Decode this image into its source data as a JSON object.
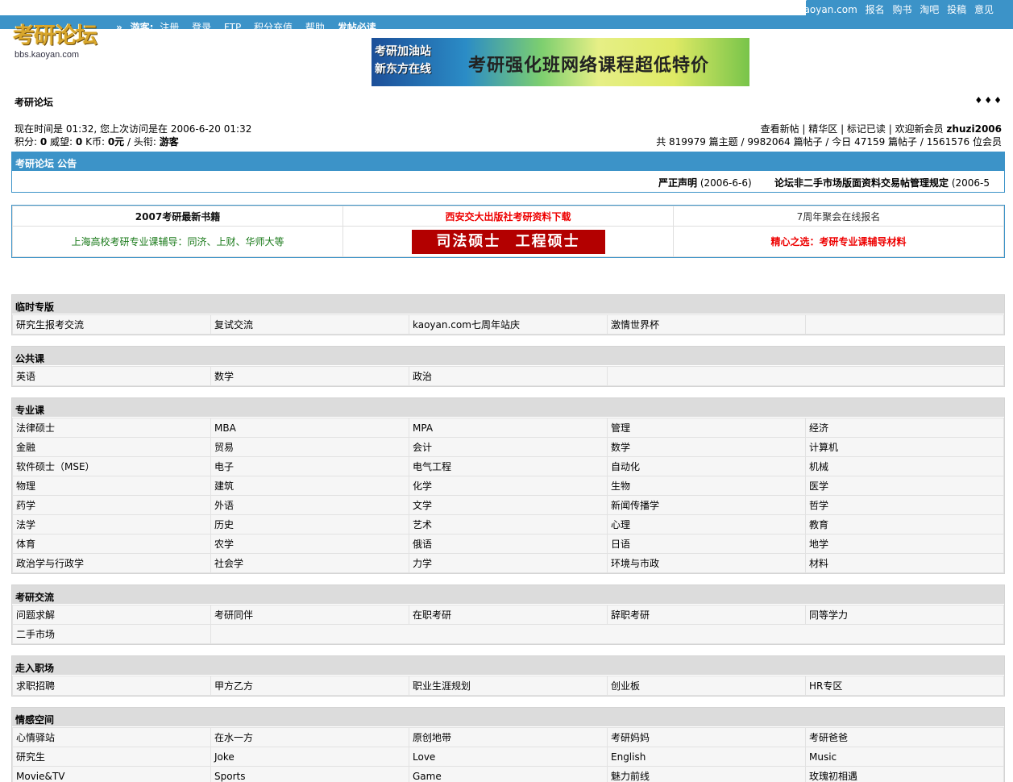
{
  "header": {
    "top_links": [
      "kaoyan.com",
      "报名",
      "购书",
      "淘吧",
      "投稿",
      "意见"
    ],
    "logo_text": "考研论坛",
    "logo_sub": "bbs.kaoyan.com",
    "nav_arrow": "»",
    "guest_label": "游客:",
    "nav_links": [
      "注册",
      "登录",
      "FTP",
      "积分充值",
      "帮助"
    ],
    "nav_bold": "发帖必读"
  },
  "banner": {
    "left_lines": [
      "考研加油站",
      "新东方在线"
    ],
    "main_text": "考研强化班网络课程超低特价"
  },
  "forum": {
    "title": "考研论坛",
    "arrows": "♦♦♦"
  },
  "info": {
    "time_line": "现在时间是  01:32, 您上次访问是在  2006-6-20 01:32",
    "points_label": "积分: ",
    "points": "0",
    "prestige_label": "  威望: ",
    "prestige": "0",
    "kb_label": "  K币: ",
    "kb": "0元",
    "title_label": "  / 头衔: ",
    "title_value": "游客",
    "right_links": "查看新帖  | 精华区  | 标记已读  | 欢迎新会员 ",
    "new_member": "zhuzi2006",
    "stats": "共  819979 篇主题  / 9982064 篇帖子  / 今日  47159 篇帖子  / 1561576 位会员"
  },
  "notice": {
    "head": "考研论坛 公告",
    "items": [
      {
        "title": "严正声明",
        "date": " (2006-6-6)"
      },
      {
        "title": "论坛非二手市场版面资料交易帖管理规定",
        "date": " (2006-5"
      }
    ]
  },
  "promo": {
    "row1": [
      "2007考研最新书籍",
      "西安交大出版社考研资料下载",
      "7周年聚会在线报名"
    ],
    "row2_left": "上海高校考研专业课辅导：同济、上财、华师大等",
    "row2_mid": "司法硕士  工程硕士",
    "row2_right": "精心之选：考研专业课辅导材料"
  },
  "categories": [
    {
      "name": "临时专版",
      "rows": [
        [
          "研究生报考交流",
          "复试交流",
          "kaoyan.com七周年站庆",
          "激情世界杯",
          ""
        ]
      ]
    },
    {
      "name": "公共课",
      "rows": [
        [
          "英语",
          "数学",
          "政治",
          ""
        ]
      ]
    },
    {
      "name": "专业课",
      "rows": [
        [
          "法律硕士",
          "MBA",
          "MPA",
          "管理",
          "经济"
        ],
        [
          "金融",
          "贸易",
          "会计",
          "数学",
          "计算机"
        ],
        [
          "软件硕士（MSE）",
          "电子",
          "电气工程",
          "自动化",
          "机械"
        ],
        [
          "物理",
          "建筑",
          "化学",
          "生物",
          "医学"
        ],
        [
          "药学",
          "外语",
          "文学",
          "新闻传播学",
          "哲学"
        ],
        [
          "法学",
          "历史",
          "艺术",
          "心理",
          "教育"
        ],
        [
          "体育",
          "农学",
          "俄语",
          "日语",
          "地学"
        ],
        [
          "政治学与行政学",
          "社会学",
          "力学",
          "环境与市政",
          "材料"
        ]
      ]
    },
    {
      "name": "考研交流",
      "rows": [
        [
          "问题求解",
          "考研同伴",
          "在职考研",
          "辞职考研",
          "同等学力"
        ],
        [
          "二手市场",
          ""
        ]
      ]
    },
    {
      "name": "走入职场",
      "rows": [
        [
          "求职招聘",
          "甲方乙方",
          "职业生涯规划",
          "创业板",
          "HR专区"
        ]
      ]
    },
    {
      "name": "情感空间",
      "rows": [
        [
          "心情驿站",
          "在水一方",
          "原创地带",
          "考研妈妈",
          "考研爸爸"
        ],
        [
          "研究生",
          "Joke",
          "Love",
          "English",
          "Music"
        ],
        [
          "Movie&TV",
          "Sports",
          "Game",
          "魅力前线",
          "玫瑰初相遇"
        ]
      ]
    }
  ]
}
